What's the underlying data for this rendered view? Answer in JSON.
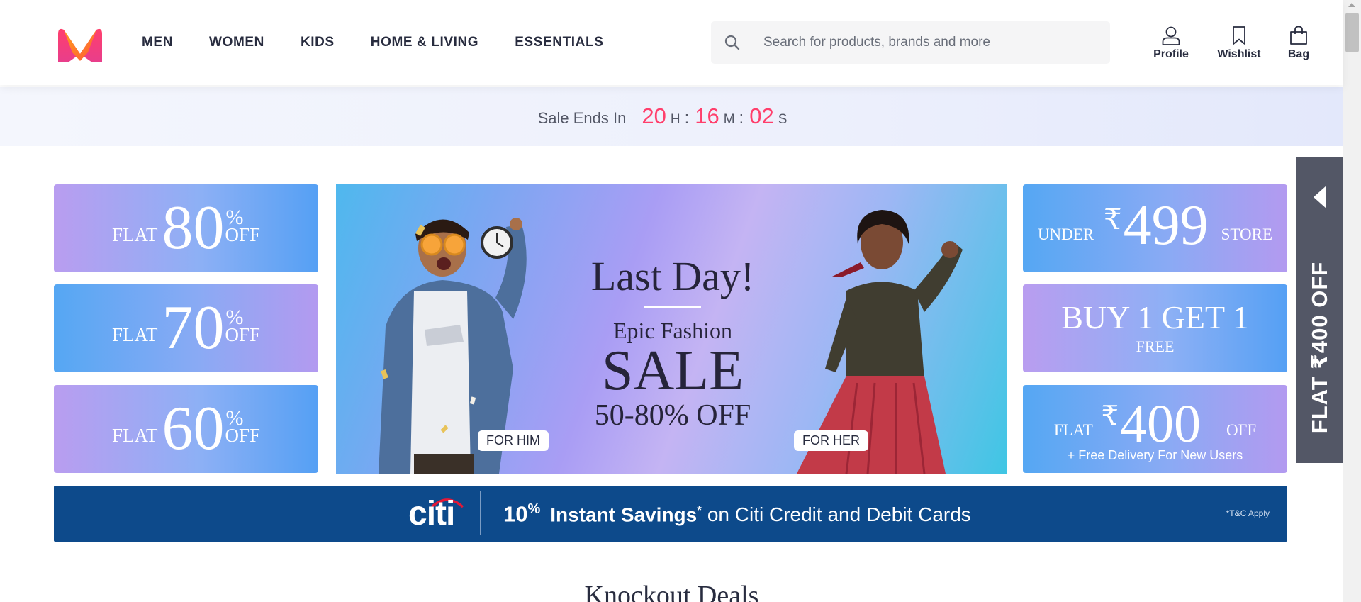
{
  "header": {
    "logo_icon": "myntra-logo-icon",
    "nav": [
      "MEN",
      "WOMEN",
      "KIDS",
      "HOME & LIVING",
      "ESSENTIALS"
    ],
    "search": {
      "placeholder": "Search for products, brands and more",
      "icon": "search-icon"
    },
    "actions": [
      {
        "label": "Profile",
        "icon": "user-icon"
      },
      {
        "label": "Wishlist",
        "icon": "bookmark-icon"
      },
      {
        "label": "Bag",
        "icon": "shopping-bag-icon"
      }
    ]
  },
  "sale_timer": {
    "label": "Sale Ends In",
    "hours": "20",
    "hours_unit": "H",
    "minutes": "16",
    "minutes_unit": "M",
    "seconds": "02",
    "seconds_unit": "S",
    "separator": ":"
  },
  "left_tiles": [
    {
      "prefix": "FLAT",
      "value": "80",
      "percent": "%",
      "suffix": "OFF"
    },
    {
      "prefix": "FLAT",
      "value": "70",
      "percent": "%",
      "suffix": "OFF"
    },
    {
      "prefix": "FLAT",
      "value": "60",
      "percent": "%",
      "suffix": "OFF"
    }
  ],
  "hero": {
    "title": "Last Day!",
    "subtitle": "Epic Fashion",
    "headline": "SALE",
    "offer": "50-80% OFF",
    "for_him": "FOR HIM",
    "for_her": "FOR HER"
  },
  "right_tiles": {
    "under": {
      "prefix": "UNDER",
      "currency": "₹",
      "value": "499",
      "suffix": "STORE"
    },
    "bogo": {
      "main": "BUY 1 GET 1",
      "sub": "FREE"
    },
    "flat": {
      "prefix": "FLAT",
      "currency": "₹",
      "value": "400",
      "suffix": "OFF",
      "sub": "+ Free Delivery For New Users"
    }
  },
  "citi_banner": {
    "brand": "citi",
    "percent": "10",
    "percent_sign": "%",
    "bold_text": "Instant Savings",
    "asterisk": "*",
    "rest": "on Citi Credit and Debit Cards",
    "terms": "*T&C Apply"
  },
  "side_tab": {
    "label": "FLAT ₹400 OFF",
    "icon": "caret-left-icon"
  },
  "section_title": "Knockout Deals",
  "colors": {
    "accent": "#ff3f6c",
    "citi_blue": "#0d4a8b",
    "side_tab": "#535766",
    "text": "#282c3f"
  }
}
